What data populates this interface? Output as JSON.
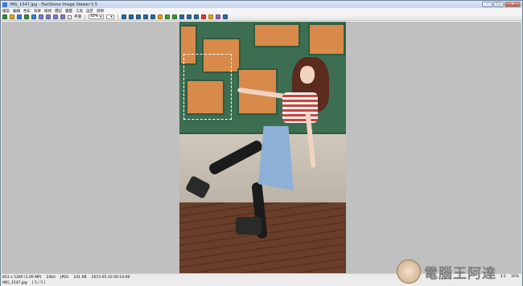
{
  "window": {
    "title": "IMG_1547.jpg - FastStone Image Viewer 5.5",
    "minimize": "–",
    "maximize": "□",
    "close": "×"
  },
  "menu": [
    "檔案",
    "編輯",
    "色彩",
    "效果",
    "檢視",
    "標記",
    "書籤",
    "工具",
    "設定",
    "說明"
  ],
  "toolbar": {
    "button_colors": [
      "#3b8a3b",
      "#d9a321",
      "#2f7fd8",
      "#3b8a3b",
      "#2f7fd8",
      "#7d7dbf",
      "#7d7dbf",
      "#7d7dbf",
      "#7d7dbf"
    ],
    "checkbox_label": "平滑",
    "zoom_value": "32%",
    "zoom_option": "",
    "right_button_colors": [
      "#2d6a9a",
      "#2d6a9a",
      "#2d6a9a",
      "#2d6a9a",
      "#2d6a9a",
      "#e0a020",
      "#3a9a3a",
      "#3a9a3a",
      "#2d6a9a",
      "#2d6a9a",
      "#2d6a9a",
      "#d04030",
      "#e0a020",
      "#9a5ac0",
      "#2d6a9a"
    ]
  },
  "status": {
    "row1": [
      "853 x 1280 (1.09 MP)",
      "24bit",
      "JPEG",
      "241 KB",
      "2015-05-10 00:14:00"
    ],
    "row2": [
      "IMG_1547.jpg",
      "[ 5 / 5 ]"
    ],
    "zoom": "1:1",
    "right_extra": "32%"
  },
  "watermark": {
    "text": "電腦王阿達"
  }
}
